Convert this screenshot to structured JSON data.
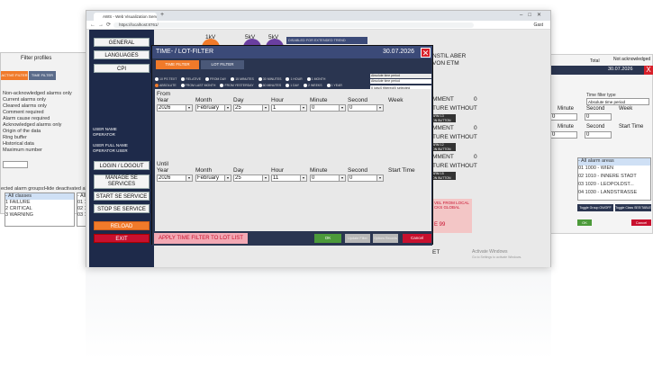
{
  "left_panel": {
    "title": "Filter profiles",
    "tab_active": "ACTIVE FILTER",
    "tab_time": "TIME FILTER",
    "options": [
      "Non-acknowledged alarms only",
      "Current alarms only",
      "Cleared alarms only",
      "Comment required",
      "Alarm cause required",
      "Acknowledged alarms only"
    ],
    "origin_title": "Origin of the data",
    "origin": [
      "Ring buffer",
      "Historical data"
    ],
    "max_label": "Maximum number",
    "alarm_groups_label": "ected alarm groups:",
    "hide_label": "Hide deactivated alar",
    "classes": [
      "- All classes",
      "1 FAILURE",
      "2 CRITICAL",
      "3 WARNING"
    ],
    "codes": [
      "- All a",
      "01 100",
      "02 101",
      "03 102"
    ]
  },
  "browser": {
    "tab_title": "AWS - Web Visualization Servic",
    "url": "https://localhost:8761/",
    "profile": "Gast"
  },
  "sidebar": {
    "general": "GENERAL",
    "languages": "LANGUAGES",
    "cpi": "CPI",
    "user_name": "USER NAME",
    "operator": "OPERATOR",
    "user_full": "USER FULL NAME",
    "operator_user": "OPERATOR USER",
    "login": "LOGIN / LOGOUT",
    "manage": "MANAGE SE SERVICES",
    "start": "START SE SERVICE",
    "stop": "STOP SE SERVICE",
    "reload": "RELOAD",
    "exit": "EXIT"
  },
  "top": {
    "gauges": [
      "1kV",
      "5kV",
      "5kV"
    ],
    "banner": "DISABLED FOR EXTENDED TREND"
  },
  "dialog": {
    "title": "TIME- / LOT-FILTER",
    "date": "30.07.2026",
    "tab_time": "TIME FILTER",
    "tab_lot": "LOT FILTER",
    "radios_row1": [
      "10 PS TEXT",
      "RELATIVE",
      "FROM DAY",
      "15 MINUTES",
      "30 MINUTES",
      "1 HOUR",
      "1 MONTH"
    ],
    "radios_row2": [
      "ABSOLUTE",
      "FROM LAST MONTH",
      "FROM YESTERDAY",
      "60 MINUTES",
      "1 DAY",
      "2 WEEKS",
      "1 YEAR"
    ],
    "period_a": "Absolute time period",
    "period_b": "Absolute time period",
    "lot_status": "0 lots/0 filtered/0 selected",
    "from_label": "From",
    "until_label": "Until",
    "cols": [
      "Year",
      "Month",
      "Day",
      "Hour",
      "Minute",
      "Second"
    ],
    "week_label": "Week",
    "start_time_label": "Start Time",
    "from": {
      "year": "2026",
      "month": "February",
      "day": "25",
      "hour": "1",
      "minute": "0",
      "second": "0"
    },
    "until": {
      "year": "2026",
      "month": "February",
      "day": "25",
      "hour": "11",
      "minute": "0",
      "second": "0"
    },
    "apply_label": "APPLY TIME FILTER TO LOT LIST",
    "ok": "OK",
    "update": "Update Filter",
    "options": "Options Records",
    "cancel": "Cancel"
  },
  "center_right": {
    "lines": [
      "NSTIL ABER",
      "VON ETM",
      "MMENT",
      "TURE WITHOUT",
      "MMENT",
      "TURE WITHOUT",
      "MMENT",
      "TURE WITHOUT"
    ],
    "zero": "0",
    "tags": [
      "ARM 13",
      "ON BUTTON",
      "ARM 12",
      "ON BUTTON",
      "ARM 15",
      "ON BUTTON"
    ],
    "red_lines": [
      "VEL FROM LOCAL",
      "CKS GLOBAL"
    ],
    "red_value": "E 99",
    "et": "ET",
    "activate1": "Activate Windows",
    "activate2": "Go to Settings to activate Windows."
  },
  "right_panel": {
    "total": "Total",
    "not_ack": "Not acknowledged",
    "date": "30.07.2026",
    "time_type": "Time filter type",
    "abs_period": "Absolute time period",
    "minute": "Minute",
    "second": "Second",
    "week": "Week",
    "start_time": "Start Time",
    "areas": [
      "- All alarm areas",
      "01 1000 - WIEN",
      "02 1010 - INNERE STADT",
      "03 1020 - LEOPOLDST...",
      "04 1030 - LANDSTRASSE"
    ],
    "toggle_on": "Toggle Group ON/OFF",
    "toggle_class": "Toggle Class SEE/TABLE",
    "ok": "OK",
    "cancel": "Cancel"
  },
  "colors": {
    "accent": "#3b4a78",
    "navy": "#1e2a4a",
    "orange": "#f07a2a",
    "red": "#c8102e",
    "gauge": "#6a3fa0",
    "green": "#4c9a3a"
  }
}
